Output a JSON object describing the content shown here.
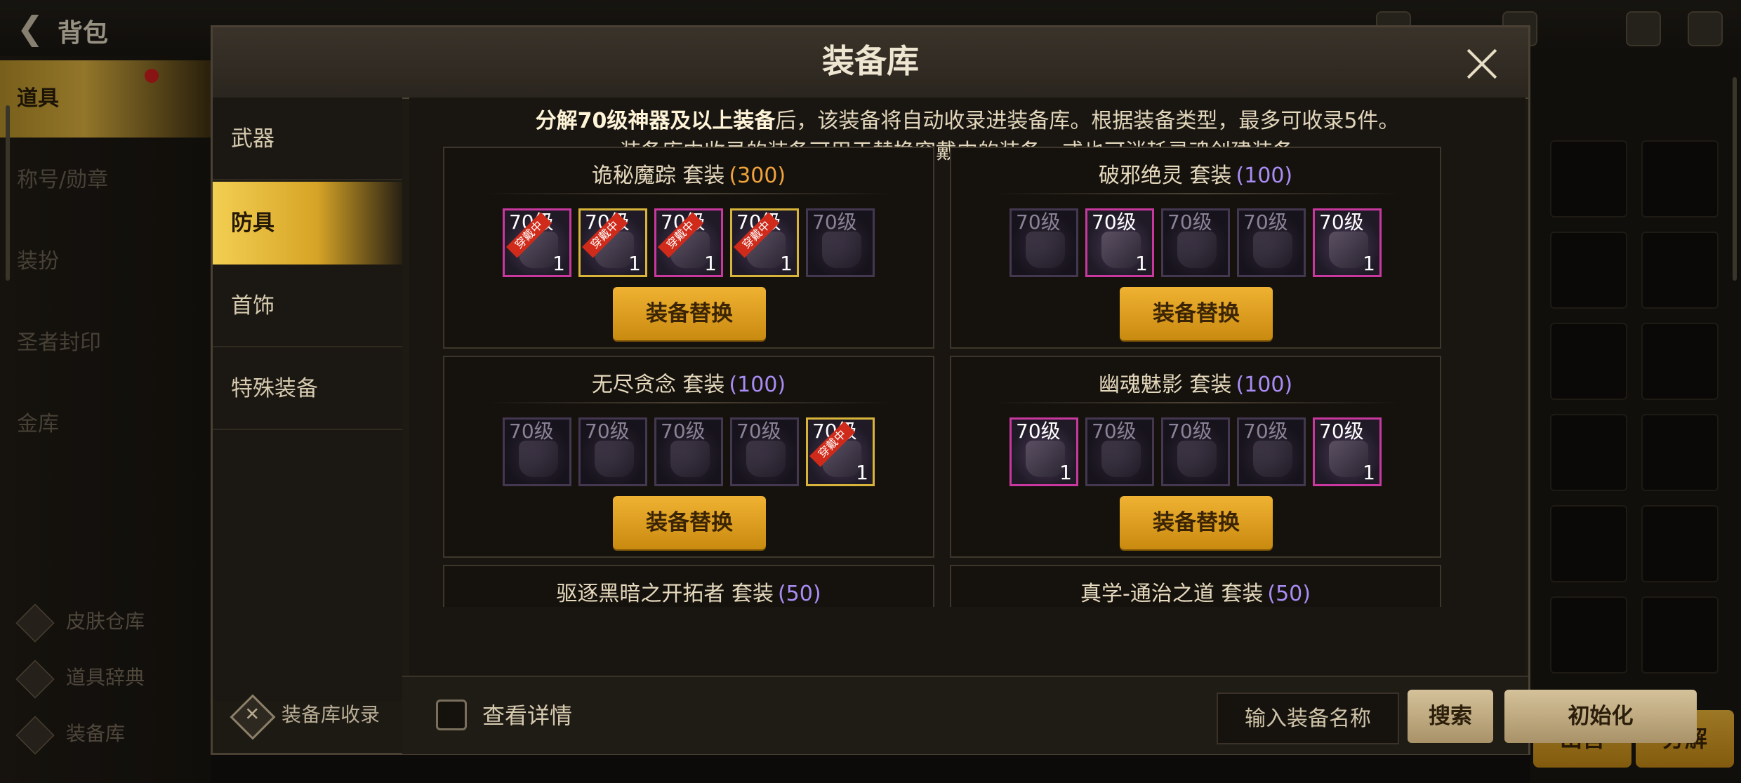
{
  "background": {
    "bag_title": "背包",
    "sidebar_items": [
      "道具",
      "称号/勋章",
      "装扮",
      "圣者封印",
      "金库"
    ],
    "bottom_links": [
      "皮肤仓库",
      "道具辞典",
      "装备库"
    ],
    "sell_label": "出售",
    "decompose_label": "分解"
  },
  "modal": {
    "title": "装备库",
    "close_icon": "close-icon",
    "categories": [
      "武器",
      "防具",
      "首饰",
      "特殊装备"
    ],
    "active_category": "防具",
    "collect_link": "装备库收录",
    "description_bold": "分解70级神器及以上装备",
    "description_line1_rest": "后，该装备将自动收录进装备库。根据装备类型，最多可收录5件。",
    "description_line2": "装备库中收录的装备可用于替换穿戴中的装备，或也可消耗灵魂创建装备。",
    "sets": [
      {
        "name": "诡秘魔踪  套装",
        "count": "(300)",
        "count_color": "#f2a43a",
        "slots": [
          {
            "level": "70级",
            "qty": "1",
            "badge": "穿戴中",
            "frame": "pink"
          },
          {
            "level": "70级",
            "qty": "1",
            "badge": "穿戴中",
            "frame": "gold"
          },
          {
            "level": "70级",
            "qty": "1",
            "badge": "穿戴中",
            "frame": "pink"
          },
          {
            "level": "70级",
            "qty": "1",
            "badge": "穿戴中",
            "frame": "gold"
          },
          {
            "level": "70级",
            "qty": "",
            "badge": "",
            "frame": "dim"
          }
        ],
        "button": "装备替换"
      },
      {
        "name": "破邪绝灵  套装",
        "count": "(100)",
        "count_color": "#a98cf3",
        "slots": [
          {
            "level": "70级",
            "qty": "",
            "badge": "",
            "frame": "dim"
          },
          {
            "level": "70级",
            "qty": "1",
            "badge": "",
            "frame": "pink"
          },
          {
            "level": "70级",
            "qty": "",
            "badge": "",
            "frame": "dim"
          },
          {
            "level": "70级",
            "qty": "",
            "badge": "",
            "frame": "dim"
          },
          {
            "level": "70级",
            "qty": "1",
            "badge": "",
            "frame": "pink"
          }
        ],
        "button": "装备替换"
      },
      {
        "name": "无尽贪念  套装",
        "count": "(100)",
        "count_color": "#a98cf3",
        "slots": [
          {
            "level": "70级",
            "qty": "",
            "badge": "",
            "frame": "dim"
          },
          {
            "level": "70级",
            "qty": "",
            "badge": "",
            "frame": "dim"
          },
          {
            "level": "70级",
            "qty": "",
            "badge": "",
            "frame": "dim"
          },
          {
            "level": "70级",
            "qty": "",
            "badge": "",
            "frame": "dim"
          },
          {
            "level": "70级",
            "qty": "1",
            "badge": "穿戴中",
            "frame": "gold"
          }
        ],
        "button": "装备替换"
      },
      {
        "name": "幽魂魅影  套装",
        "count": "(100)",
        "count_color": "#a98cf3",
        "slots": [
          {
            "level": "70级",
            "qty": "1",
            "badge": "",
            "frame": "pink"
          },
          {
            "level": "70级",
            "qty": "",
            "badge": "",
            "frame": "dim"
          },
          {
            "level": "70级",
            "qty": "",
            "badge": "",
            "frame": "dim"
          },
          {
            "level": "70级",
            "qty": "",
            "badge": "",
            "frame": "dim"
          },
          {
            "level": "70级",
            "qty": "1",
            "badge": "",
            "frame": "pink"
          }
        ],
        "button": "装备替换"
      },
      {
        "name": "驱逐黑暗之开拓者  套装",
        "count": "(50)",
        "count_color": "#a98cf3",
        "slots": [],
        "button": ""
      },
      {
        "name": "真学-通治之道 套装",
        "count": "(50)",
        "count_color": "#a98cf3",
        "slots": [],
        "button": ""
      }
    ],
    "footer": {
      "view_details_label": "查看详情",
      "view_details_checked": false,
      "search_placeholder": "输入装备名称",
      "search_button": "搜索",
      "reset_button": "初始化"
    }
  }
}
